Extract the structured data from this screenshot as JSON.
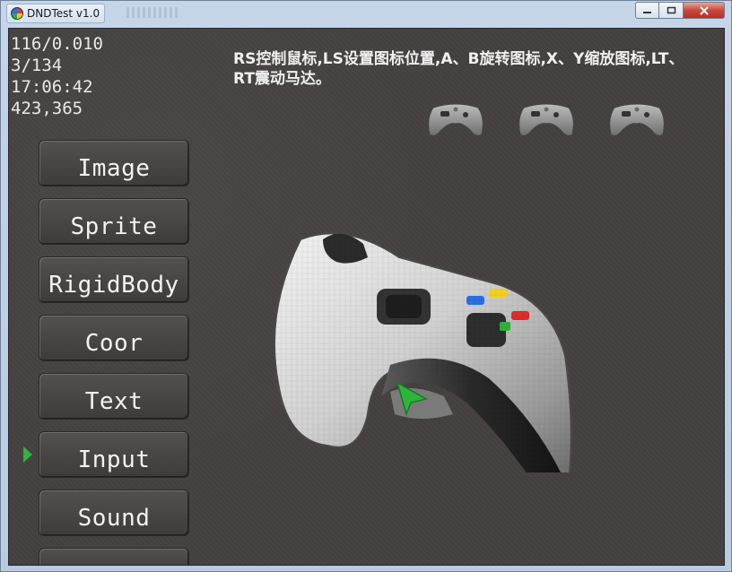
{
  "window": {
    "title": "DNDTest v1.0",
    "controls": {
      "minimize_icon": "minimize-icon",
      "maximize_icon": "maximize-icon",
      "close_icon": "close-icon"
    }
  },
  "stats": {
    "line1": "116/0.010",
    "line2": "3/134",
    "line3": "17:06:42",
    "line4": "423,365"
  },
  "instructions": {
    "text": "RS控制鼠标,LS设置图标位置,A、B旋转图标,X、Y缩放图标,LT、RT震动马达。"
  },
  "menu": {
    "items": [
      {
        "label": "Image"
      },
      {
        "label": "Sprite"
      },
      {
        "label": "RigidBody"
      },
      {
        "label": "Coor"
      },
      {
        "label": "Text"
      },
      {
        "label": "Input"
      },
      {
        "label": "Sound"
      },
      {
        "label": ""
      }
    ],
    "selected": "Input"
  },
  "colors": {
    "background": "#444040",
    "marker": "#2db43a",
    "button_yellow": "#f4d21a",
    "button_blue": "#2a6fe0",
    "button_red": "#e02a2a",
    "button_green": "#2db43a"
  }
}
